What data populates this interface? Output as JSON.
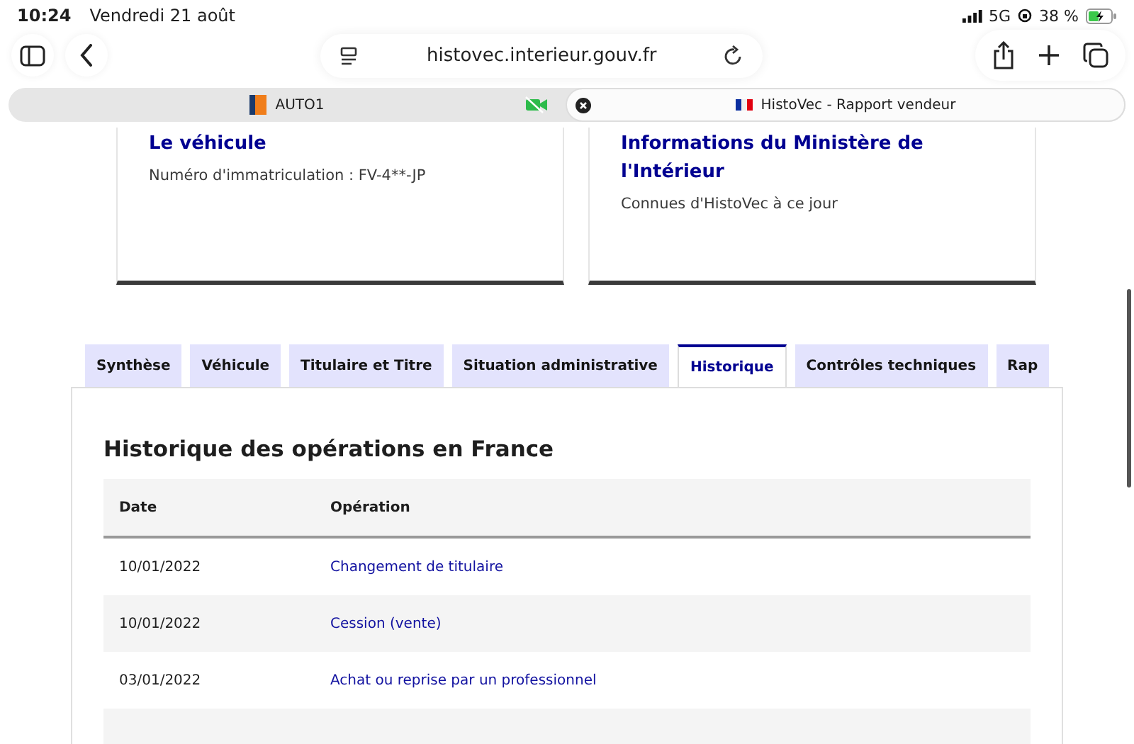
{
  "status_bar": {
    "time": "10:24",
    "date": "Vendredi 21 août",
    "network": "5G",
    "battery": "38 %"
  },
  "toolbar": {
    "url": "histovec.interieur.gouv.fr"
  },
  "browser_tabs": [
    {
      "label": "AUTO1",
      "selected": false
    },
    {
      "label": "HistoVec - Rapport vendeur",
      "selected": true
    }
  ],
  "cards": [
    {
      "title": "Le véhicule",
      "text": "Numéro d'immatriculation : FV-4**-JP"
    },
    {
      "title": "Informations du Ministère de l'Intérieur",
      "text": "Connues d'HistoVec à ce jour"
    }
  ],
  "tabs": [
    {
      "label": "Synthèse",
      "selected": false
    },
    {
      "label": "Véhicule",
      "selected": false
    },
    {
      "label": "Titulaire et Titre",
      "selected": false
    },
    {
      "label": "Situation administrative",
      "selected": false
    },
    {
      "label": "Historique",
      "selected": true
    },
    {
      "label": "Contrôles techniques",
      "selected": false
    },
    {
      "label": "Rap",
      "selected": false
    }
  ],
  "section_title": "Historique des opérations en France",
  "table": {
    "columns": [
      "Date",
      "Opération"
    ],
    "rows": [
      [
        "10/01/2022",
        "Changement de titulaire"
      ],
      [
        "10/01/2022",
        "Cession (vente)"
      ],
      [
        "03/01/2022",
        "Achat ou reprise par un professionnel"
      ]
    ]
  }
}
